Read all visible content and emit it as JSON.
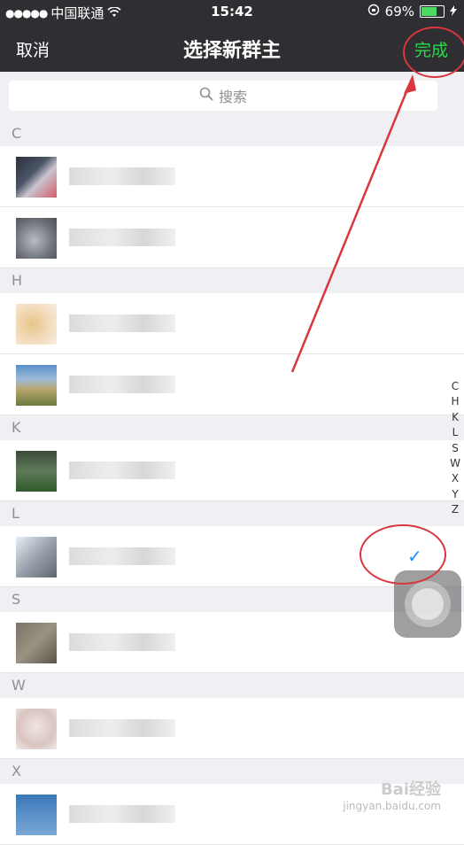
{
  "status_bar": {
    "signal": "●●●●●",
    "carrier": "中国联通",
    "time": "15:42",
    "battery_percent": "69%",
    "battery_level": 0.69
  },
  "nav": {
    "cancel_label": "取消",
    "title": "选择新群主",
    "done_label": "完成"
  },
  "search": {
    "placeholder": "搜索"
  },
  "sections": [
    {
      "letter": "C"
    },
    {
      "letter": "H"
    },
    {
      "letter": "K"
    },
    {
      "letter": "L"
    },
    {
      "letter": "S"
    },
    {
      "letter": "W"
    },
    {
      "letter": "X"
    }
  ],
  "index_letters": [
    "C",
    "H",
    "K",
    "L",
    "S",
    "W",
    "X",
    "Y",
    "Z"
  ],
  "selected": {
    "mark": "✓"
  },
  "watermark": {
    "logo": "Bai经验",
    "url": "jingyan.baidu.com"
  },
  "colors": {
    "accent_green": "#2bd94a",
    "check_blue": "#1a8cff",
    "bar_dark": "#2f2f33",
    "annotation_red": "#d9363e"
  }
}
